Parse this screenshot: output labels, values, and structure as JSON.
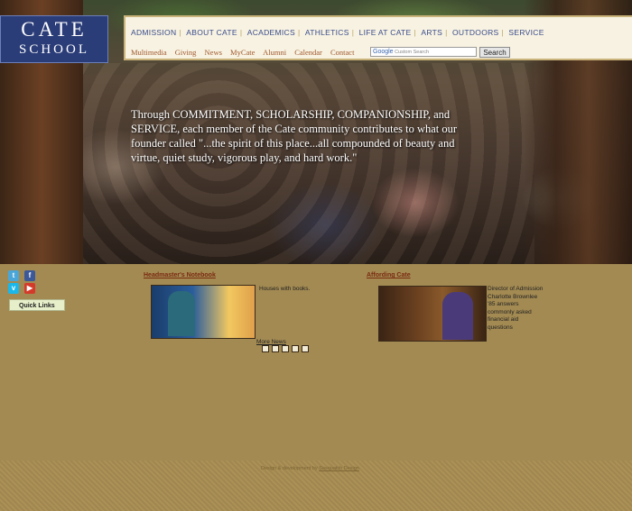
{
  "logo": {
    "line1": "CATE",
    "line2": "SCHOOL"
  },
  "nav": {
    "primary": [
      "ADMISSION",
      "ABOUT CATE",
      "ACADEMICS",
      "ATHLETICS",
      "LIFE AT CATE",
      "ARTS",
      "OUTDOORS",
      "SERVICE"
    ],
    "secondary": [
      "Multimedia",
      "Giving",
      "News",
      "MyCate",
      "Alumni",
      "Calendar",
      "Contact"
    ]
  },
  "search": {
    "google": "Google",
    "placeholder": "Custom Search",
    "button": "Search"
  },
  "hero": {
    "quote": "Through COMMITMENT, SCHOLARSHIP, COMPANIONSHIP, and SERVICE, each member of the Cate community contributes to what our founder called \"...the spirit of this place...all compounded of beauty and virtue, quiet study, vigorous play, and hard work.\""
  },
  "social": {
    "icons": [
      "twitter-icon",
      "facebook-icon",
      "vimeo-icon",
      "youtube-icon"
    ]
  },
  "quick_links": {
    "label": "Quick Links"
  },
  "headmaster": {
    "title": "Headmaster's Notebook",
    "caption": "Houses with books.",
    "more": "More News"
  },
  "affording": {
    "title": "Affording Cate",
    "caption": "Director of Admission Charlotte Brownlee '85 answers commonly asked financial aid questions"
  },
  "footer": {
    "credit_prefix": "Design & development by",
    "credit_link": "Sasquatch Design"
  },
  "colors": {
    "navy": "#2b3d78",
    "tan": "#a38a52",
    "nav_text": "#3a4c8c",
    "subnav_text": "#a0582f"
  }
}
